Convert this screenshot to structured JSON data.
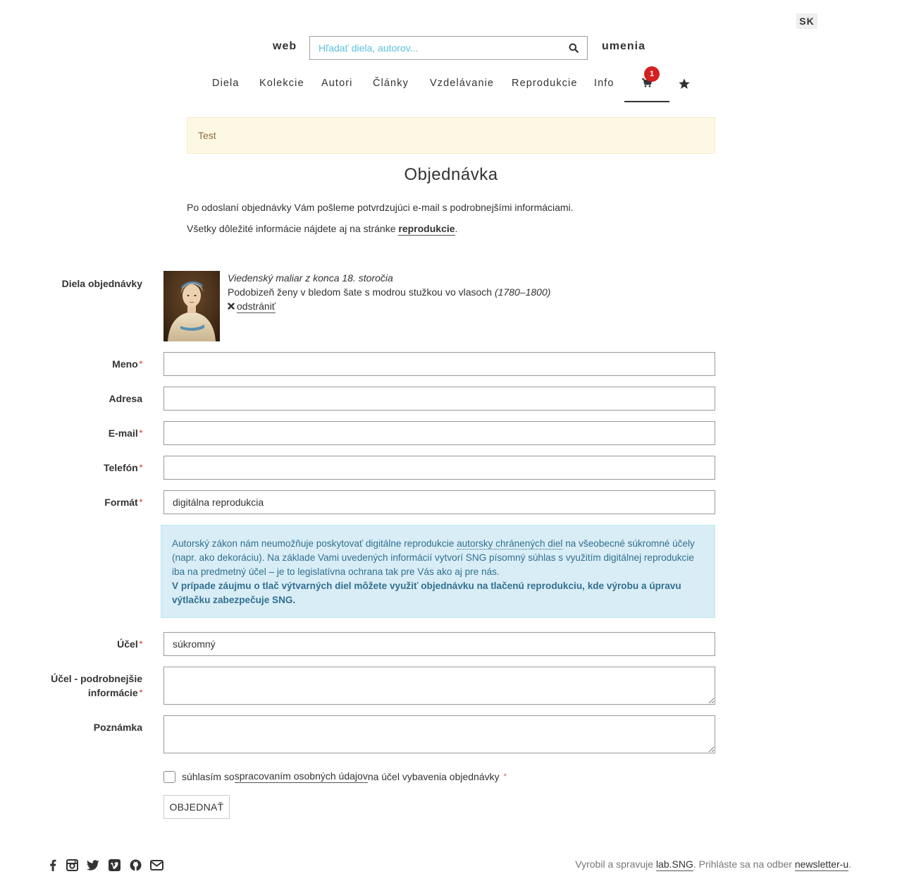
{
  "language": "SK",
  "header": {
    "brand_left": "web",
    "brand_right": "umenia",
    "search_placeholder": "Hľadať diela, autorov..."
  },
  "nav": {
    "items": [
      "Diela",
      "Kolekcie",
      "Autori",
      "Články",
      "Vzdelávanie",
      "Reprodukcie",
      "Info"
    ],
    "cart_count": "1"
  },
  "alert": {
    "text": "Test"
  },
  "page": {
    "title": "Objednávka",
    "intro1": "Po odoslaní objednávky Vám pošleme potvrdzujúci e-mail s podrobnejšími informáciami.",
    "intro2_before": "Všetky dôležité informácie nájdete aj na stránke ",
    "intro2_link": "reprodukcie",
    "intro2_after": "."
  },
  "form": {
    "artworks_label": "Diela objednávky",
    "artwork": {
      "author": "Viedenský maliar z konca 18. storočia",
      "title": "Podobizeň ženy v bledom šate s modrou stužkou vo vlasoch",
      "date": "(1780–1800)",
      "remove_label": "odstrániť"
    },
    "name_label": "Meno",
    "address_label": "Adresa",
    "email_label": "E-mail",
    "phone_label": "Telefón",
    "format_label": "Formát",
    "format_value": "digitálna reprodukcia",
    "info": {
      "part1": "Autorský zákon nám neumožňuje poskytovať digitálne reprodukcie ",
      "abbr": "autorsky chránených diel",
      "part2": " na všeobecné súkromné účely (napr. ako dekoráciu). Na základe Vami uvedených informácií vytvorí SNG písomný súhlas s využitím digitálnej reprodukcie iba na predmetný účel – je to legislatívna ochrana tak pre Vás ako aj pre nás.",
      "strong": "V prípade záujmu o tlač výtvarných diel môžete využiť objednávku na tlačenú reprodukciu, kde výrobu a úpravu výtlačku zabezpečuje SNG."
    },
    "purpose_label": "Účel",
    "purpose_value": "súkromný",
    "purpose_detail_label_1": "Účel - podrobnejšie",
    "purpose_detail_label_2": "informácie",
    "note_label": "Poznámka",
    "consent_before": "súhlasím so ",
    "consent_link": "spracovaním osobných údajov",
    "consent_after": " na účel vybavenia objednávky",
    "submit_label": "OBJEDNAŤ",
    "required_mark": "*"
  },
  "footer": {
    "text_before": "Vyrobil a spravuje ",
    "lab_link": "lab.SNG",
    "text_middle": ". Prihláste sa na odber ",
    "newsletter_link": "newsletter-u",
    "text_after": ".",
    "social_icons": [
      "facebook-icon",
      "instagram-icon",
      "twitter-icon",
      "vimeo-icon",
      "github-icon",
      "envelope-icon"
    ]
  },
  "colors": {
    "alert_bg": "#fcf8e3",
    "info_bg": "#d9edf7",
    "info_text": "#31708f",
    "badge": "#d42020",
    "placeholder": "#5bc0de"
  }
}
